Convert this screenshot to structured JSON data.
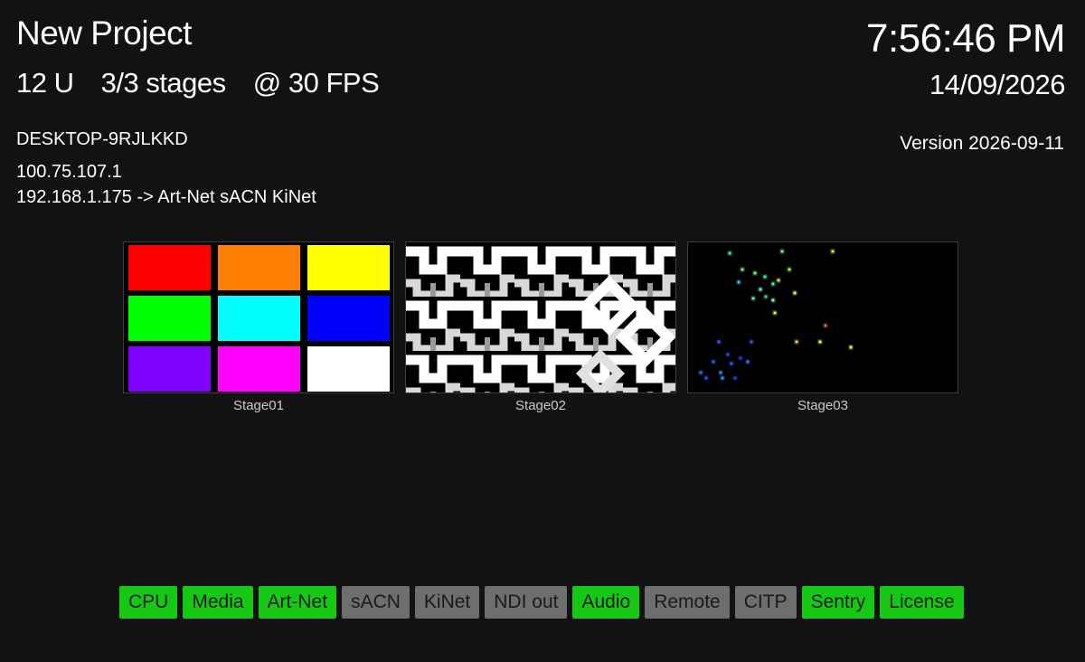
{
  "project": {
    "title": "New Project",
    "universes": "12 U",
    "stages": "3/3 stages",
    "fps": "@ 30 FPS"
  },
  "clock": {
    "time": "7:56:46 PM",
    "date": "14/09/2026"
  },
  "machine": {
    "hostname": "DESKTOP-9RJLKKD",
    "ips": [
      "100.75.107.1",
      "192.168.1.175  -> Art-Net sACN KiNet"
    ],
    "version": "Version 2026-09-11"
  },
  "stages": [
    {
      "label": "Stage01",
      "preview": "color-grid",
      "colors": [
        "#ff0000",
        "#ff8000",
        "#ffff00",
        "#00ff00",
        "#00ffff",
        "#0000ff",
        "#8000ff",
        "#ff00ff",
        "#ffffff"
      ]
    },
    {
      "label": "Stage02",
      "preview": "maze-pattern"
    },
    {
      "label": "Stage03",
      "preview": "particles"
    }
  ],
  "status": [
    {
      "label": "CPU",
      "active": true
    },
    {
      "label": "Media",
      "active": true
    },
    {
      "label": "Art-Net",
      "active": true
    },
    {
      "label": "sACN",
      "active": false
    },
    {
      "label": "KiNet",
      "active": false
    },
    {
      "label": "NDI out",
      "active": false
    },
    {
      "label": "Audio",
      "active": true
    },
    {
      "label": "Remote",
      "active": false
    },
    {
      "label": "CITP",
      "active": false
    },
    {
      "label": "Sentry",
      "active": true
    },
    {
      "label": "License",
      "active": true
    }
  ],
  "colors": {
    "status_on": "#14c814",
    "status_off": "#6e6e6e",
    "background": "#121212"
  }
}
